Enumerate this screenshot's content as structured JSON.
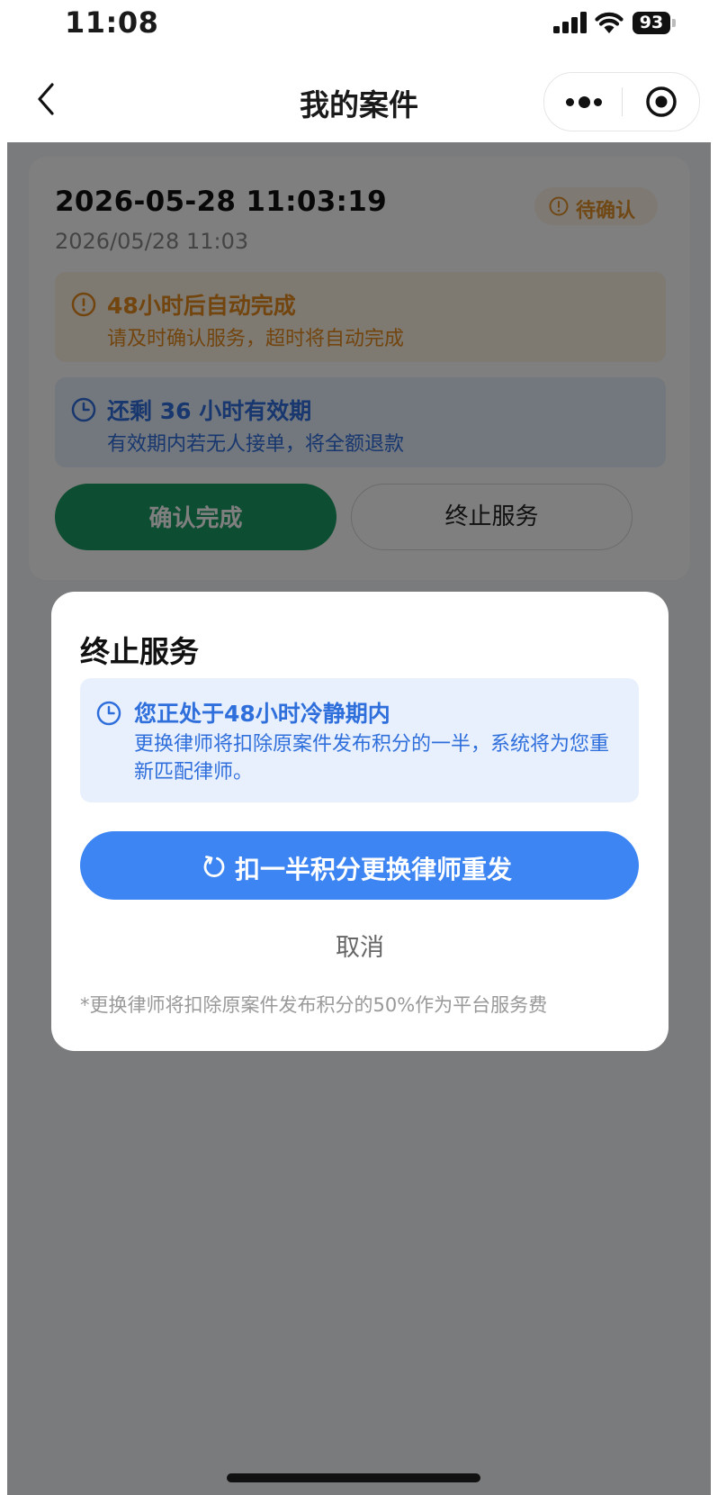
{
  "status_bar": {
    "time": "11:08",
    "battery": "93"
  },
  "nav": {
    "title": "我的案件"
  },
  "case_card": {
    "date_title": "2026-05-28 11:03:19",
    "date_sub": "2026/05/28 11:03",
    "status_badge": "待确认",
    "auto_complete_notice": {
      "title": "48小时后自动完成",
      "desc": "请及时确认服务，超时将自动完成"
    },
    "validity_notice": {
      "title": "还剩 36 小时有效期",
      "desc": "有效期内若无人接单，将全额退款"
    },
    "confirm_button": "确认完成",
    "stop_button": "终止服务"
  },
  "dialog": {
    "title": "终止服务",
    "info_title": "您正处于48小时冷静期内",
    "info_desc": "更换律师将扣除原案件发布积分的一半，系统将为您重新匹配律师。",
    "primary_button": "扣一半积分更换律师重发",
    "cancel_button": "取消",
    "footnote": "*更换律师将扣除原案件发布积分的50%作为平台服务费"
  },
  "colors": {
    "accent_blue": "#3d85f2",
    "warning_orange": "#e58a1f",
    "confirm_green": "#1a9a62"
  }
}
